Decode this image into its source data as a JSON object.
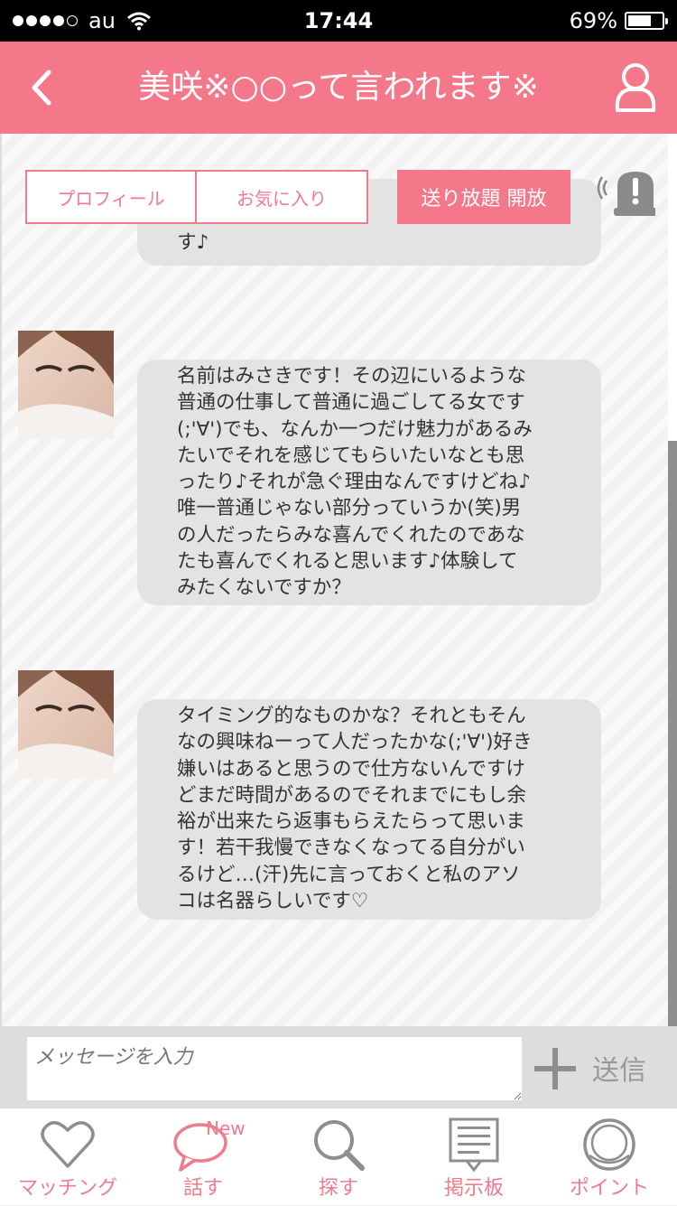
{
  "status_bar": {
    "carrier": "au",
    "time": "17:44",
    "battery": "69%",
    "battery_level": 0.69
  },
  "header": {
    "title": "美咲※○○って言われます※",
    "back_icon": "back-chevron-icon",
    "profile_icon": "user-icon"
  },
  "tabs": {
    "profile": "プロフィール",
    "favorite": "お気に入り",
    "unlimited": "送り放題 開放"
  },
  "messages": [
    {
      "lines": [
        "す♪"
      ]
    },
    {
      "lines": [
        "名前はみさきです！その辺にいるような",
        "普通の仕事して普通に過ごしてる女です",
        "(;'∀')でも、なんか一つだけ魅力があるみ",
        "たいでそれを感じてもらいたいなとも思",
        "ったり♪それが急ぐ理由なんですけどね♪",
        "唯一普通じゃない部分っていうか(笑)男",
        "の人だったらみな喜んでくれたのであな",
        "たも喜んでくれると思います♪体験して",
        "みたくないですか？"
      ]
    },
    {
      "lines": [
        "タイミング的なものかな？それともそん",
        "なの興味ねーって人だったかな(;'∀')好き",
        "嫌いはあると思うので仕方ないんですけ",
        "どまだ時間があるのでそれまでにもし余",
        "裕が出来たら返事もらえたらって思いま",
        "す！若干我慢できなくなってる自分がい",
        "るけど…(汗)先に言っておくと私のアソ",
        "コは名器らしいです♡"
      ]
    }
  ],
  "input": {
    "placeholder": "メッセージを入力",
    "send_label": "送信"
  },
  "tabbar": {
    "items": [
      {
        "label": "マッチング",
        "icon": "heart-icon"
      },
      {
        "label": "話す",
        "icon": "speech-bubble-icon",
        "badge": "New"
      },
      {
        "label": "探す",
        "icon": "search-icon"
      },
      {
        "label": "掲示板",
        "icon": "board-icon"
      },
      {
        "label": "ポイント",
        "icon": "coin-icon"
      }
    ]
  },
  "colors": {
    "accent": "#f47889",
    "bubble": "#e3e3e3"
  }
}
